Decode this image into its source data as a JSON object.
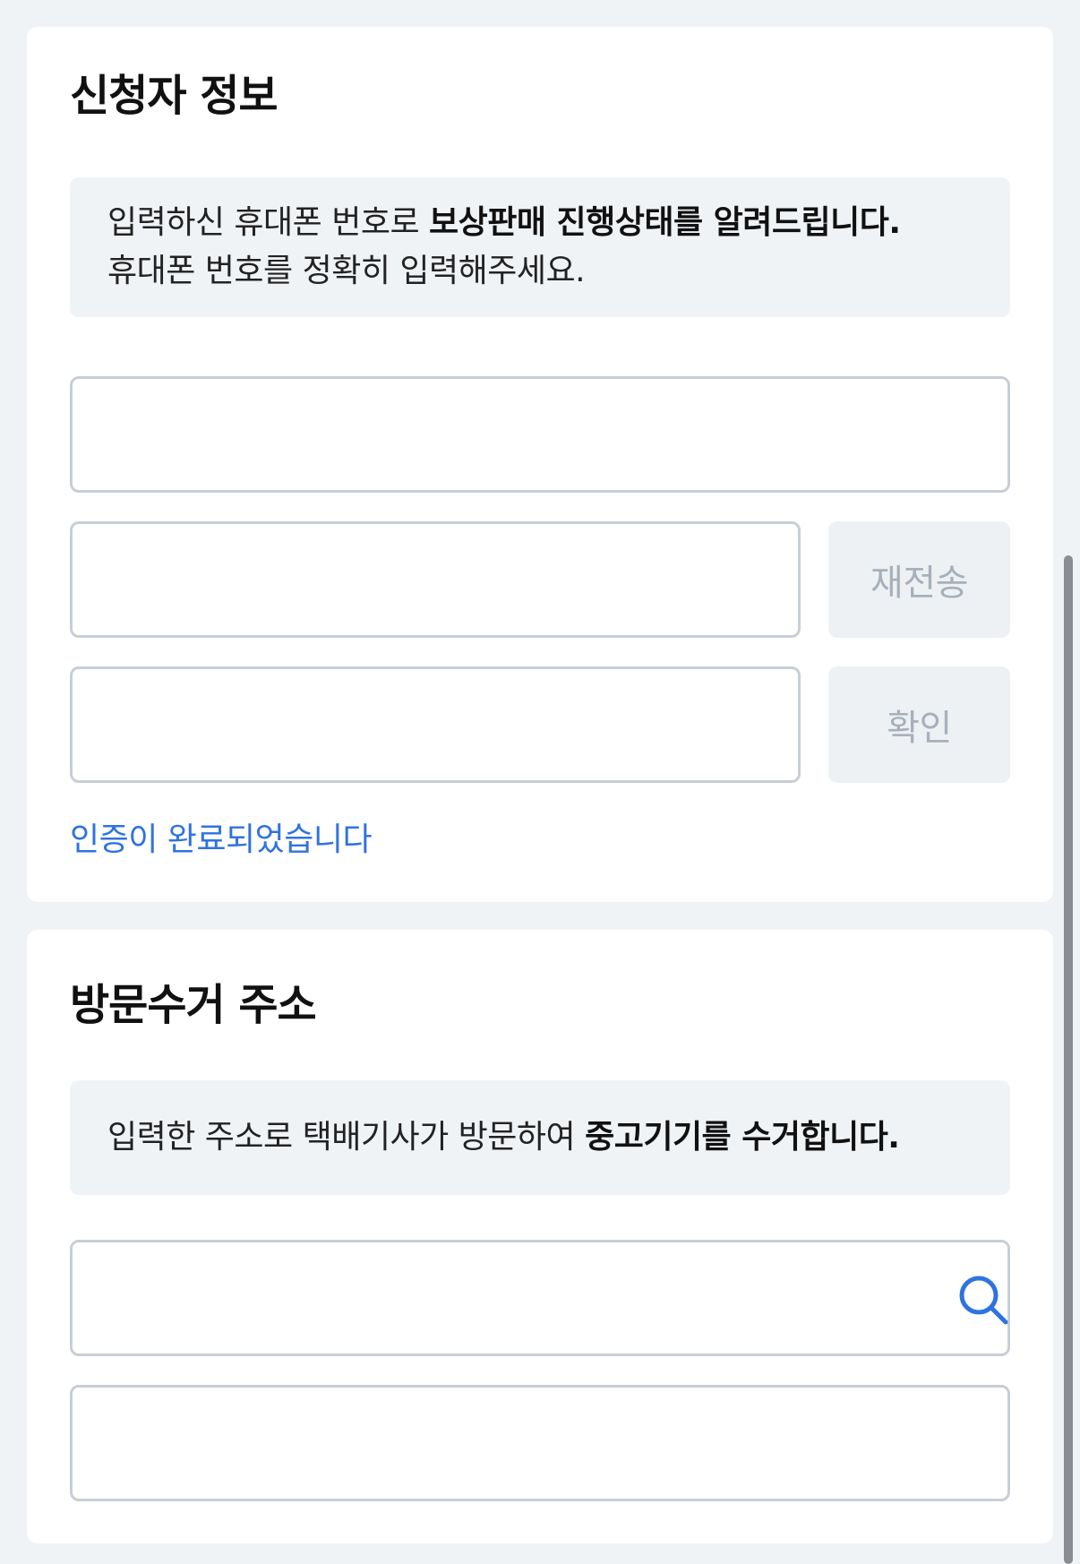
{
  "applicant": {
    "title": "신청자 정보",
    "notice_line1_prefix": "입력하신 휴대폰 번호로 ",
    "notice_line1_bold": "보상판매 진행상태를 알려드립니다.",
    "notice_line2": "휴대폰 번호를 정확히 입력해주세요.",
    "phone_input": {
      "value": "",
      "placeholder": ""
    },
    "code_input": {
      "value": "",
      "placeholder": ""
    },
    "resend_button": "재전송",
    "confirm_input": {
      "value": "",
      "placeholder": ""
    },
    "confirm_button": "확인",
    "status_message": "인증이 완료되었습니다"
  },
  "address": {
    "title": "방문수거 주소",
    "notice_prefix": "입력한 주소로 택배기사가 방문하여 ",
    "notice_bold": "중고기기를 수거합니다.",
    "address_input": {
      "value": "",
      "placeholder": ""
    },
    "detail_input": {
      "value": "",
      "placeholder": ""
    }
  },
  "icons": {
    "search": "search-icon"
  },
  "colors": {
    "background": "#f0f3f6",
    "card": "#ffffff",
    "accent_blue": "#2f73e0",
    "disabled_button_text": "#a7b0ba",
    "field_border": "#c8ced6"
  }
}
